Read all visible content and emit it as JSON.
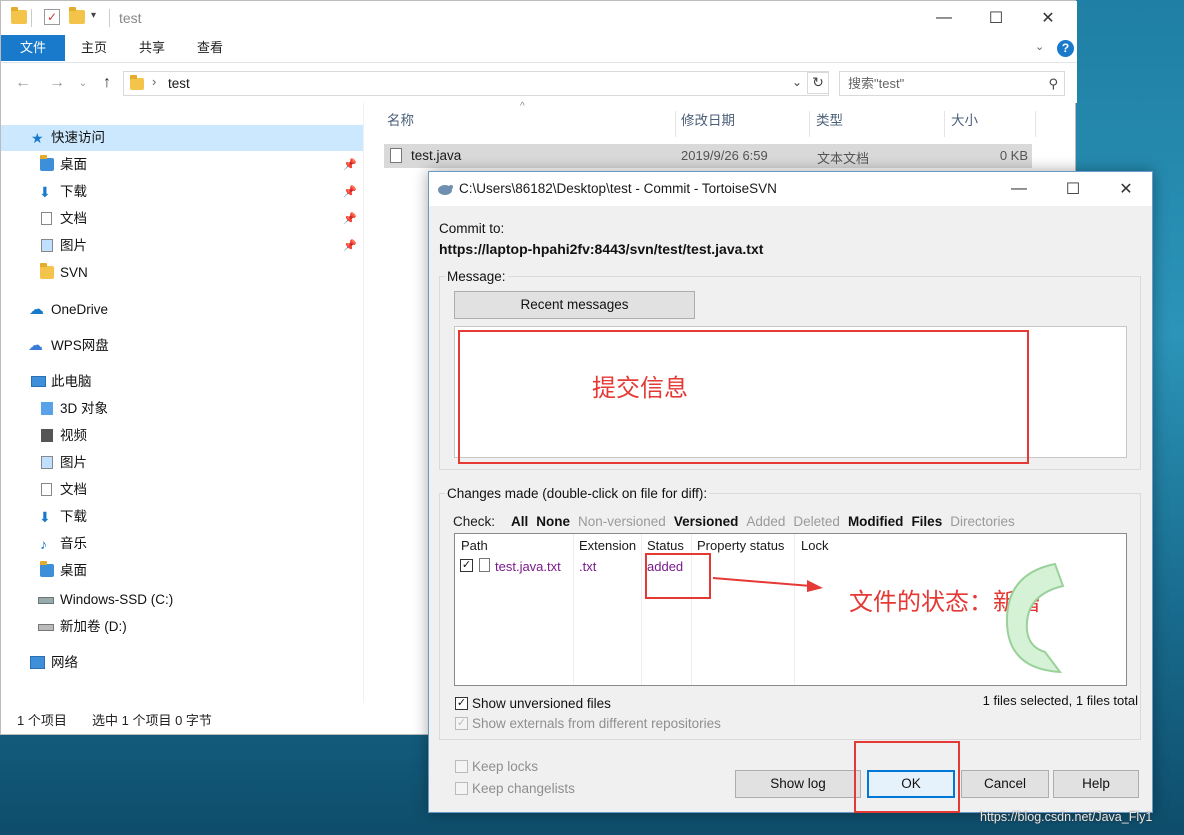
{
  "explorer": {
    "window_title": "test",
    "ribbon_tabs": [
      "文件",
      "主页",
      "共享",
      "查看"
    ],
    "address_path": "test",
    "search_placeholder": "搜索\"test\"",
    "nav": {
      "quick_access": "快速访问",
      "quick_items": [
        "桌面",
        "下载",
        "文档",
        "图片",
        "SVN"
      ],
      "onedrive": "OneDrive",
      "wps": "WPS网盘",
      "this_pc": "此电脑",
      "pc_items": [
        "3D 对象",
        "视频",
        "图片",
        "文档",
        "下载",
        "音乐",
        "桌面",
        "Windows-SSD (C:)",
        "新加卷 (D:)"
      ],
      "network": "网络"
    },
    "columns": [
      "名称",
      "修改日期",
      "类型",
      "大小"
    ],
    "file": {
      "name": "test.java",
      "date": "2019/9/26 6:59",
      "type": "文本文档",
      "size": "0 KB"
    },
    "status_items": "1 个项目",
    "status_selected": "选中 1 个项目  0 字节"
  },
  "dialog": {
    "title": "C:\\Users\\86182\\Desktop\\test - Commit - TortoiseSVN",
    "commit_to_label": "Commit to:",
    "commit_url": "https://laptop-hpahi2fv:8443/svn/test/test.java.txt",
    "message_label": "Message:",
    "recent_messages": "Recent messages",
    "message_annotation": "提交信息",
    "changes_label": "Changes made (double-click on file for diff):",
    "check_label": "Check:",
    "filters": [
      {
        "label": "All",
        "bold": true
      },
      {
        "label": "None",
        "bold": true
      },
      {
        "label": "Non-versioned",
        "bold": false
      },
      {
        "label": "Versioned",
        "bold": true
      },
      {
        "label": "Added",
        "bold": false
      },
      {
        "label": "Deleted",
        "bold": false
      },
      {
        "label": "Modified",
        "bold": true
      },
      {
        "label": "Files",
        "bold": true
      },
      {
        "label": "Directories",
        "bold": false
      }
    ],
    "table_columns": [
      "Path",
      "Extension",
      "Status",
      "Property status",
      "Lock"
    ],
    "row": {
      "checked": true,
      "path": "test.java.txt",
      "extension": ".txt",
      "status": "added"
    },
    "status_annotation": "文件的状态：新增",
    "show_unversioned": "Show unversioned files",
    "show_externals": "Show externals from different repositories",
    "files_summary": "1 files selected, 1 files total",
    "keep_locks": "Keep locks",
    "keep_changelists": "Keep changelists",
    "buttons": {
      "show_log": "Show log",
      "ok": "OK",
      "cancel": "Cancel",
      "help": "Help"
    },
    "watermark": "https://blog.csdn.net/Java_Fly1"
  },
  "colors": {
    "accent": "#1979ca",
    "annotation_red": "#e53935",
    "svn_added": "#7a1a8c"
  }
}
